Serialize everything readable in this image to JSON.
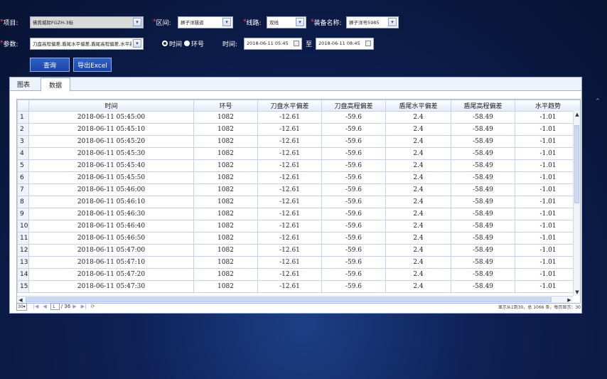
{
  "filters": {
    "project": {
      "label": "项目:",
      "value": "佛莞城际FGZH-3标"
    },
    "section": {
      "label": "区间:",
      "value": "狮子洋隧道"
    },
    "line": {
      "label": "线路:",
      "value": "双线"
    },
    "equipment": {
      "label": "装备名称:",
      "value": "狮子洋号5985"
    },
    "params": {
      "label": "参数:",
      "value": "刀盘高程偏差,盾尾水平偏差,盾尾高程偏差,水平趋势"
    },
    "mode_time": "时间",
    "mode_ring": "环号",
    "time_label": "时间:",
    "time_from": "2018-06-11 05:45",
    "to_label": "至",
    "time_to": "2018-06-11 08:45"
  },
  "buttons": {
    "query": "查询",
    "export": "导出Excel"
  },
  "tabs": {
    "chart": "图表",
    "data": "数据"
  },
  "table": {
    "columns": [
      "时间",
      "环号",
      "刀盘水平偏差",
      "刀盘高程偏差",
      "盾尾水平偏差",
      "盾尾高程偏差",
      "水平趋势"
    ],
    "rows": [
      [
        "1",
        "2018-06-11 05:45:00",
        "1082",
        "-12.61",
        "-59.6",
        "2.4",
        "-58.49",
        "-1.01"
      ],
      [
        "2",
        "2018-06-11 05:45:10",
        "1082",
        "-12.61",
        "-59.6",
        "2.4",
        "-58.49",
        "-1.01"
      ],
      [
        "3",
        "2018-06-11 05:45:20",
        "1082",
        "-12.61",
        "-59.6",
        "2.4",
        "-58.49",
        "-1.01"
      ],
      [
        "4",
        "2018-06-11 05:45:30",
        "1082",
        "-12.61",
        "-59.6",
        "2.4",
        "-58.49",
        "-1.01"
      ],
      [
        "5",
        "2018-06-11 05:45:40",
        "1082",
        "-12.61",
        "-59.6",
        "2.4",
        "-58.49",
        "-1.01"
      ],
      [
        "6",
        "2018-06-11 05:45:50",
        "1082",
        "-12.61",
        "-59.6",
        "2.4",
        "-58.49",
        "-1.01"
      ],
      [
        "7",
        "2018-06-11 05:46:00",
        "1082",
        "-12.61",
        "-59.6",
        "2.4",
        "-58.49",
        "-1.01"
      ],
      [
        "8",
        "2018-06-11 05:46:10",
        "1082",
        "-12.61",
        "-59.6",
        "2.4",
        "-58.49",
        "-1.01"
      ],
      [
        "9",
        "2018-06-11 05:46:30",
        "1082",
        "-12.61",
        "-59.6",
        "2.4",
        "-58.49",
        "-1.01"
      ],
      [
        "10",
        "2018-06-11 05:46:40",
        "1082",
        "-12.61",
        "-59.6",
        "2.4",
        "-58.49",
        "-1.01"
      ],
      [
        "11",
        "2018-06-11 05:46:50",
        "1082",
        "-12.61",
        "-59.6",
        "2.4",
        "-58.49",
        "-1.01"
      ],
      [
        "12",
        "2018-06-11 05:47:00",
        "1082",
        "-12.61",
        "-59.6",
        "2.4",
        "-58.49",
        "-1.01"
      ],
      [
        "13",
        "2018-06-11 05:47:10",
        "1082",
        "-12.61",
        "-59.6",
        "2.4",
        "-58.49",
        "-1.01"
      ],
      [
        "14",
        "2018-06-11 05:47:20",
        "1082",
        "-12.61",
        "-59.6",
        "2.4",
        "-58.49",
        "-1.01"
      ],
      [
        "15",
        "2018-06-11 05:47:30",
        "1082",
        "-12.61",
        "-59.6",
        "2.4",
        "-58.49",
        "-1.01"
      ]
    ]
  },
  "pager": {
    "page_size": "30",
    "current_page": "1",
    "total_pages": "/ 36",
    "info": "显示从1到30，总 1066 条，每页显示：30"
  },
  "colors": {
    "accent": "#1b45a6",
    "required": "#ff4b4b"
  }
}
